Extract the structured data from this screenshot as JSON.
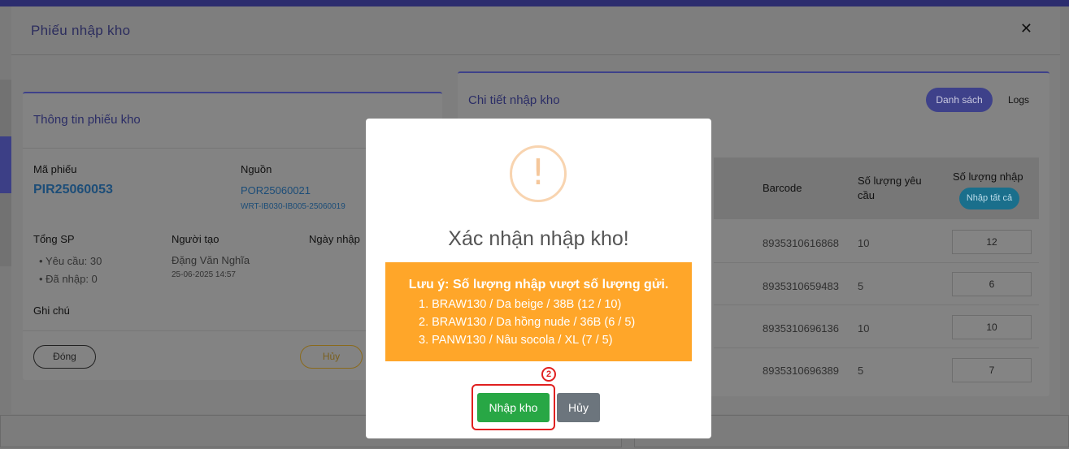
{
  "modal": {
    "title": "Phiếu nhập kho",
    "close_icon": "close-icon"
  },
  "left_card": {
    "title": "Thông tin phiếu kho",
    "code_label": "Mã phiếu",
    "code_value": "PIR25060053",
    "source_label": "Nguồn",
    "source_value": "POR25060021",
    "source_sub": "WRT-IB030-IB005-25060019",
    "total_label": "Tổng SP",
    "requested": "Yêu cầu: 30",
    "imported": "Đã nhập: 0",
    "creator_label": "Người tạo",
    "creator_name": "Đặng Văn Nghĩa",
    "created_at": "25-06-2025 14:57",
    "date_label": "Ngày nhập",
    "note_label": "Ghi chú",
    "close_button": "Đóng",
    "cancel_button": "Hủy"
  },
  "right_card": {
    "title": "Chi tiết nhập kho",
    "list_tab": "Danh sách",
    "logs_tab": "Logs",
    "columns": {
      "barcode": "Barcode",
      "requested_qty": "Số lượng yêu cầu",
      "import_qty": "Số lượng nhập",
      "import_all": "Nhập tất cả"
    },
    "rows": [
      {
        "barcode": "8935310616868",
        "requested": "10",
        "import": "12"
      },
      {
        "barcode": "8935310659483",
        "requested": "5",
        "import": "6"
      },
      {
        "barcode": "8935310696136",
        "requested": "10",
        "import": "10"
      },
      {
        "barcode": "8935310696389",
        "requested": "5",
        "import": "7"
      }
    ]
  },
  "dialog": {
    "icon": "!",
    "title": "Xác nhận nhập kho!",
    "notice_heading": "Lưu ý: Số lượng nhập vượt số lượng gửi.",
    "notice_items": [
      "1. BRAW130 / Da beige / 38B (12 / 10)",
      "2. BRAW130 / Da hồng nude / 36B (6 / 5)",
      "3. PANW130 / Nâu socola / XL (7 / 5)"
    ],
    "step_badge": "2",
    "confirm_button": "Nhập kho",
    "cancel_button": "Hủy",
    "colors": {
      "notice_bg": "#ffa629",
      "confirm_bg": "#28a745",
      "cancel_bg": "#6c757d",
      "highlight": "#e02020"
    }
  }
}
